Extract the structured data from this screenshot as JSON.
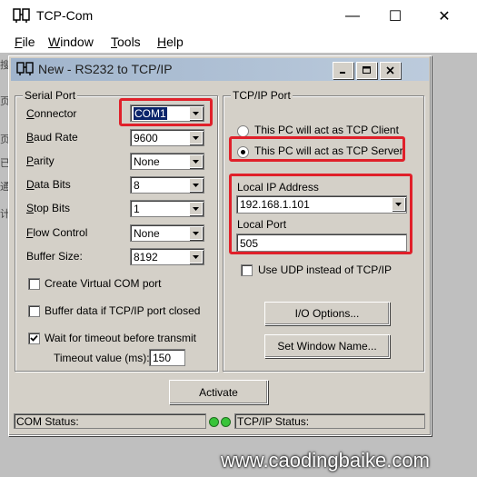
{
  "outer_window": {
    "title": "TCP-Com",
    "controls": {
      "minimize": "—",
      "maximize": "☐",
      "close": "✕"
    },
    "menu": [
      {
        "underline": "F",
        "rest": "ile"
      },
      {
        "underline": "W",
        "rest": "indow"
      },
      {
        "underline": "T",
        "rest": "ools"
      },
      {
        "underline": "H",
        "rest": "elp"
      }
    ],
    "edge_text": [
      "搜",
      "页",
      "页",
      "已",
      "通",
      "计"
    ]
  },
  "dialog": {
    "title": "New - RS232 to TCP/IP",
    "serial_port": {
      "group_label": "Serial Port",
      "connector": {
        "label_ul": "C",
        "label_rest": "onnector",
        "value": "COM1"
      },
      "baud_rate": {
        "label_ul": "B",
        "label_rest": "aud Rate",
        "value": "9600"
      },
      "parity": {
        "label_ul": "P",
        "label_rest": "arity",
        "value": "None"
      },
      "data_bits": {
        "label_ul": "D",
        "label_rest": "ata Bits",
        "value": "8"
      },
      "stop_bits": {
        "label_ul": "S",
        "label_rest": "top Bits",
        "value": "1"
      },
      "flow_control": {
        "label_ul": "F",
        "label_rest": "low Control",
        "value": "None"
      },
      "buffer_size": {
        "label": "Buffer Size:",
        "value": "8192"
      },
      "create_virtual_com": {
        "label": "Create Virtual COM port",
        "checked": false
      },
      "buffer_data": {
        "label": "Buffer data if TCP/IP port closed",
        "checked": false
      },
      "wait_timeout": {
        "label": "Wait for timeout before transmit",
        "checked": true
      },
      "timeout_value": {
        "label": "Timeout value (ms):",
        "value": "150"
      }
    },
    "tcpip_port": {
      "group_label": "TCP/IP Port",
      "client_option": {
        "label": "This PC will act as TCP Client",
        "selected": false
      },
      "server_option": {
        "label": "This PC will act as TCP Server",
        "selected": true
      },
      "local_ip": {
        "label": "Local IP Address",
        "value": "192.168.1.101"
      },
      "local_port": {
        "label": "Local Port",
        "value": "505"
      },
      "use_udp": {
        "label": "Use UDP instead of TCP/IP",
        "checked": false
      },
      "io_options_button": "I/O Options...",
      "set_window_name_button": "Set Window Name..."
    },
    "activate_button": "Activate",
    "status_bar": {
      "com_status": "COM Status:",
      "tcpip_status": "TCP/IP Status:",
      "led_color": "#39c439"
    }
  },
  "highlight_color": "#e0202a",
  "watermark": "www.caodingbaike.com"
}
